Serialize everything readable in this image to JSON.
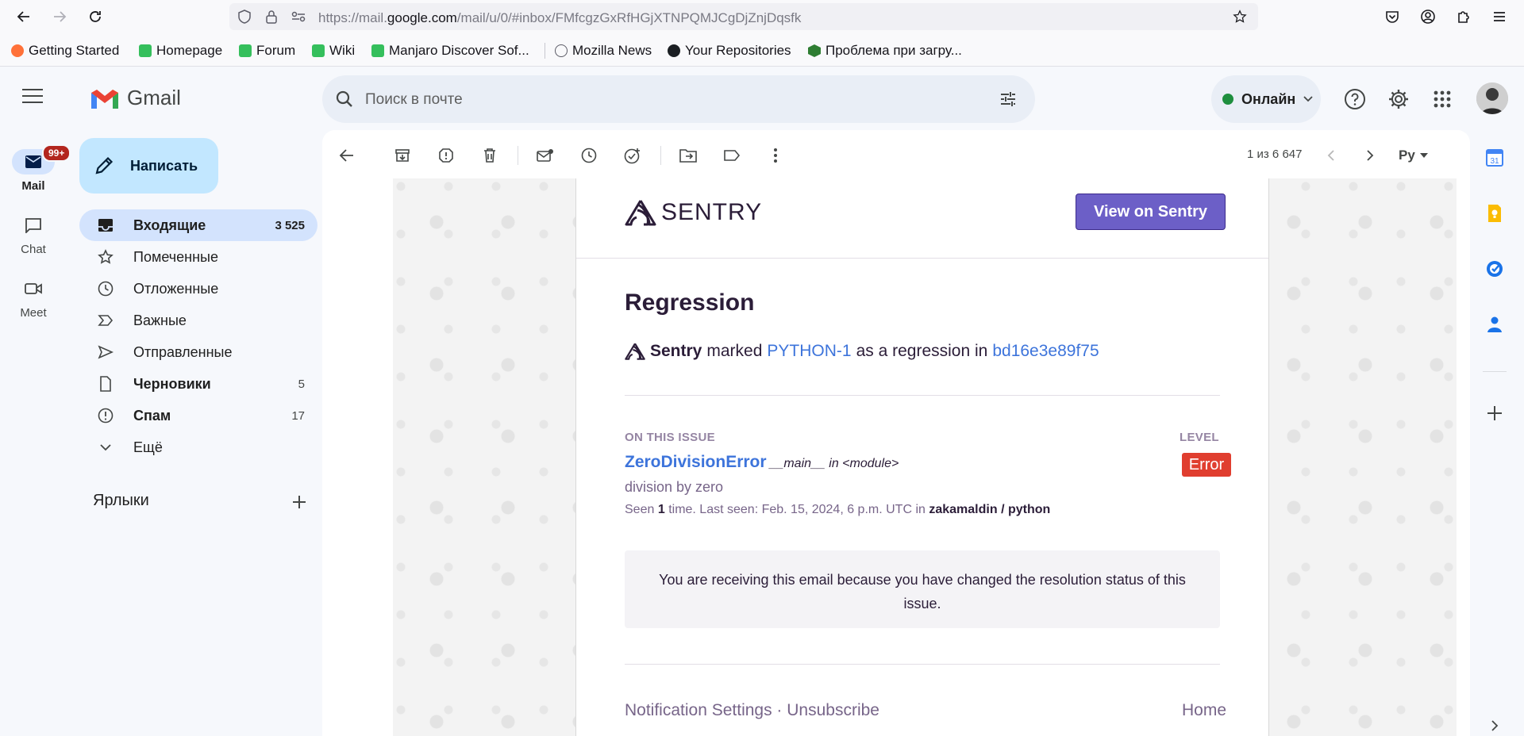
{
  "browser": {
    "url_prefix": "https://mail.",
    "url_host": "google.com",
    "url_path": "/mail/u/0/#inbox/FMfcgzGxRfHGjXTNPQMJCgDjZnjDqsfk"
  },
  "bookmarks": [
    {
      "label": "Getting Started",
      "color": "#ff7139"
    },
    {
      "label": "Homepage",
      "color": "#35bf5c"
    },
    {
      "label": "Forum",
      "color": "#35bf5c"
    },
    {
      "label": "Wiki",
      "color": "#35bf5c"
    },
    {
      "label": "Manjaro Discover Sof...",
      "color": "#35bf5c"
    },
    {
      "label": "Mozilla News",
      "color": "#5b5b66"
    },
    {
      "label": "Your Repositories",
      "color": "#1b1f23"
    },
    {
      "label": "Проблема при загру...",
      "color": "#2e7d32"
    }
  ],
  "rail": {
    "mail": {
      "label": "Mail",
      "badge": "99+"
    },
    "chat": {
      "label": "Chat"
    },
    "meet": {
      "label": "Meet"
    }
  },
  "header": {
    "app_name": "Gmail",
    "search_placeholder": "Поиск в почте",
    "status": "Онлайн"
  },
  "compose": {
    "label": "Написать"
  },
  "folders": [
    {
      "label": "Входящие",
      "count": "3 525",
      "bold": true,
      "active": true
    },
    {
      "label": "Помеченные",
      "count": ""
    },
    {
      "label": "Отложенные",
      "count": ""
    },
    {
      "label": "Важные",
      "count": ""
    },
    {
      "label": "Отправленные",
      "count": ""
    },
    {
      "label": "Черновики",
      "count": "5",
      "bold": true
    },
    {
      "label": "Спам",
      "count": "17",
      "bold": true
    },
    {
      "label": "Ещё",
      "count": ""
    }
  ],
  "labels_heading": "Ярлыки",
  "pager": {
    "text": "1 из 6 647",
    "lang": "Ру"
  },
  "email": {
    "brand": "SENTRY",
    "view_button": "View on Sentry",
    "title": "Regression",
    "actor": "Sentry",
    "marked_text": "marked",
    "issue_id": "PYTHON-1",
    "as_text": "as a regression in",
    "release": "bd16e3e89f75",
    "on_this_issue": "ON THIS ISSUE",
    "level_heading": "LEVEL",
    "error_name": "ZeroDivisionError",
    "error_location": "__main__ in <module>",
    "error_message": "division by zero",
    "seen_prefix": "Seen",
    "seen_count": "1",
    "seen_suffix": "time. Last seen: Feb. 15, 2024, 6 p.m. UTC in",
    "project": "zakamaldin / python",
    "level": "Error",
    "notice": "You are receiving this email because you have changed the resolution status of this issue.",
    "footer_left": "Notification Settings · Unsubscribe",
    "footer_right": "Home"
  },
  "colors": {
    "sentry_purple": "#6c5fc7",
    "link_blue": "#3d74db",
    "error_red": "#e03e2f",
    "online_green": "#1e8e3e"
  }
}
